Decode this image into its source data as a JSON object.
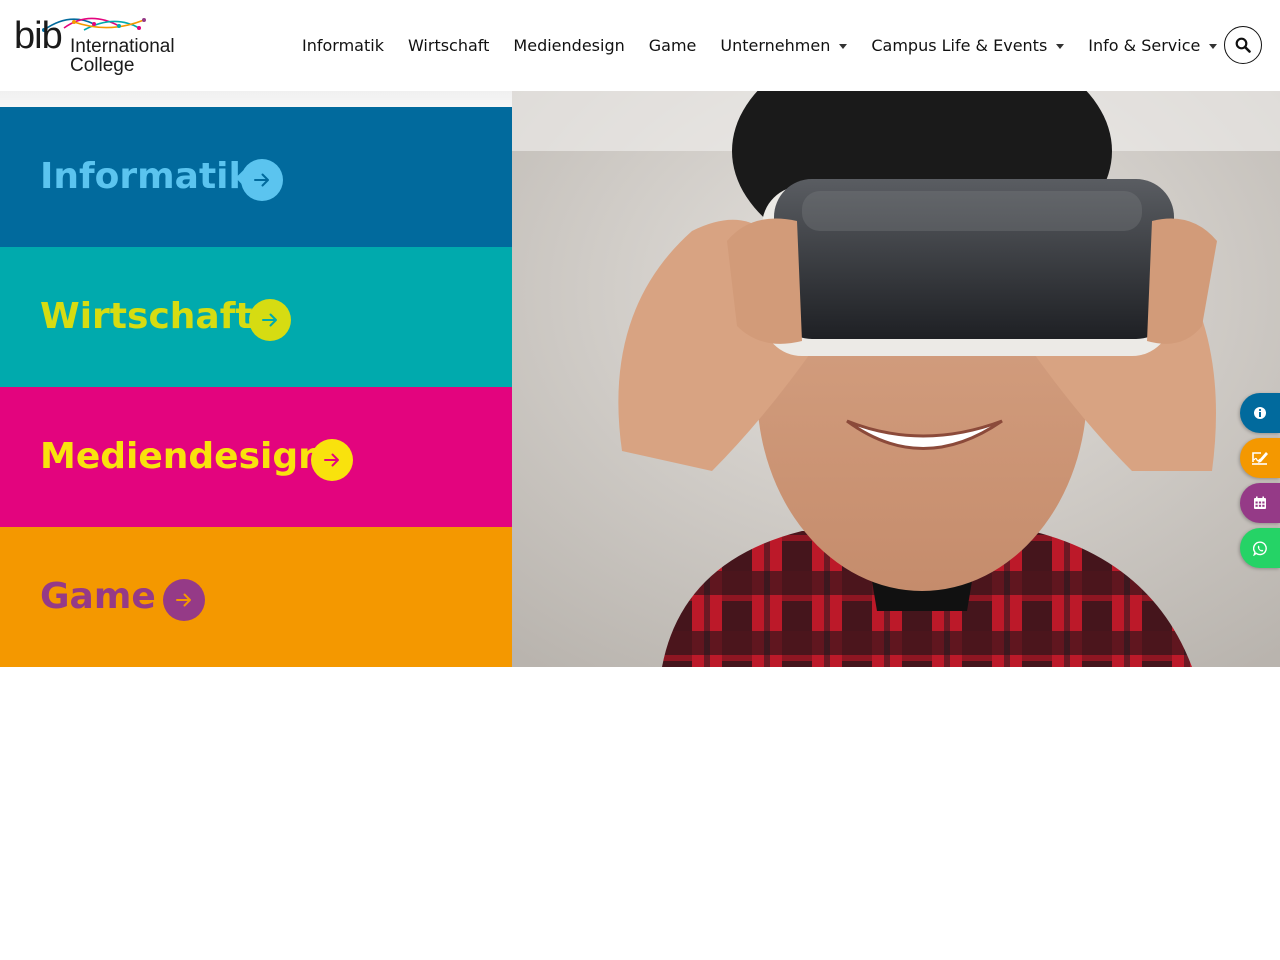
{
  "header": {
    "logo": {
      "mark": "bib",
      "line1": "International",
      "line2": "College"
    },
    "nav": [
      {
        "label": "Informatik",
        "has_dropdown": false
      },
      {
        "label": "Wirtschaft",
        "has_dropdown": false
      },
      {
        "label": "Mediendesign",
        "has_dropdown": false
      },
      {
        "label": "Game",
        "has_dropdown": false
      },
      {
        "label": "Unternehmen",
        "has_dropdown": true
      },
      {
        "label": "Campus Life & Events",
        "has_dropdown": true
      },
      {
        "label": "Info & Service",
        "has_dropdown": true
      }
    ],
    "search_icon": "search-icon"
  },
  "tiles": [
    {
      "label": "Informatik",
      "bg": "#016a9d",
      "text_color": "#5bc4ef",
      "arrow_bg": "#5bc4ef",
      "arrow_color": "#016a9d"
    },
    {
      "label": "Wirtschaft",
      "bg": "#00aaad",
      "text_color": "#d6dc12",
      "arrow_bg": "#d6dc12",
      "arrow_color": "#00aaad"
    },
    {
      "label": "Mediendesign",
      "bg": "#e3047e",
      "text_color": "#f9e20d",
      "arrow_bg": "#f9e20d",
      "arrow_color": "#e3047e"
    },
    {
      "label": "Game",
      "bg": "#f49800",
      "text_color": "#953a87",
      "arrow_bg": "#953a87",
      "arrow_color": "#f49800"
    }
  ],
  "hero": {
    "description": "vr-headset-photo"
  },
  "side_actions": [
    {
      "icon": "info-icon",
      "color": "#016a9d"
    },
    {
      "icon": "signature-icon",
      "color": "#f49800"
    },
    {
      "icon": "calendar-icon",
      "color": "#953a87"
    },
    {
      "icon": "whatsapp-icon",
      "color": "#25d366"
    }
  ]
}
